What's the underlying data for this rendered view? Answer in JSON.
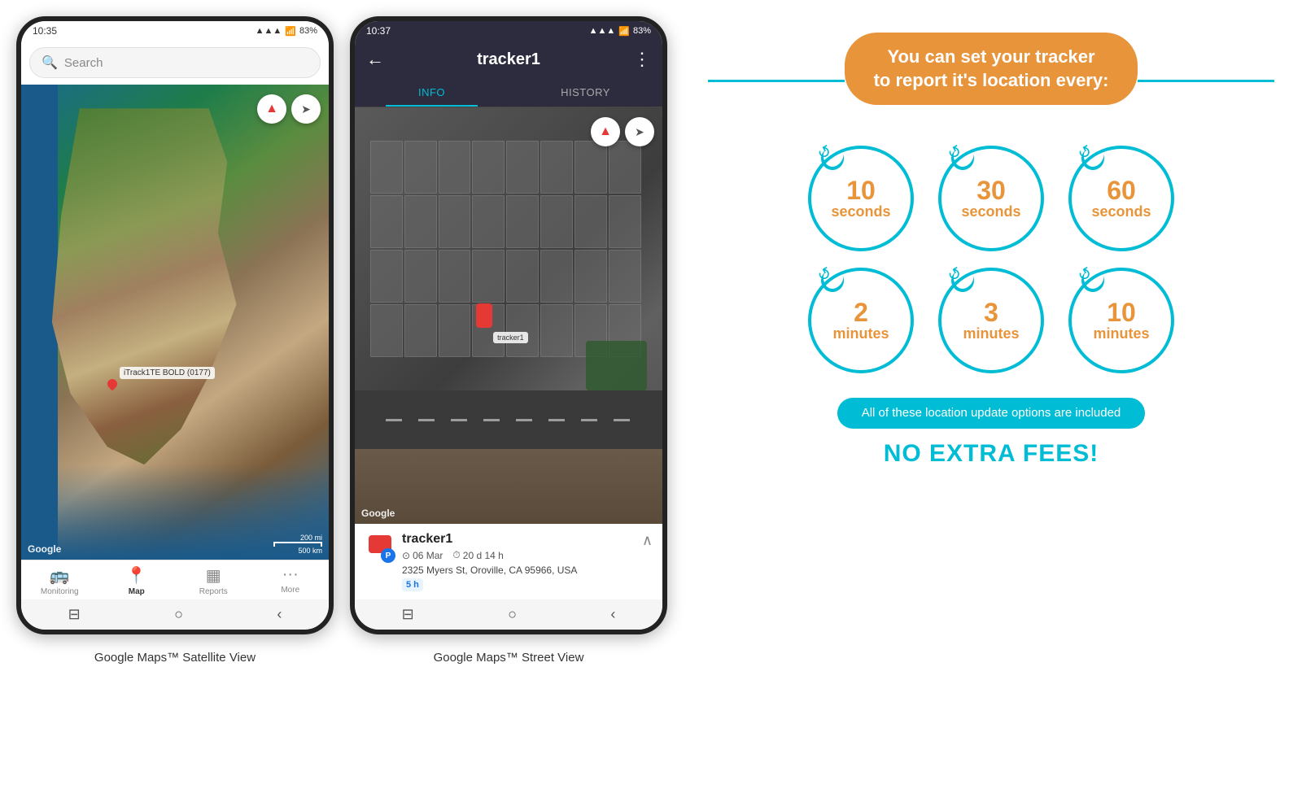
{
  "phone1": {
    "status_time": "10:35",
    "status_signal": "▲▲▲",
    "status_battery": "83%",
    "search_placeholder": "Search",
    "compass_icon": "⬆",
    "share_icon": "➤",
    "tracker_label": "iTrack1TE BOLD (0177)",
    "google_text": "Google",
    "scale_200mi": "200 mi",
    "scale_500km": "500 km",
    "nav": {
      "monitoring": "Monitoring",
      "map": "Map",
      "reports": "Reports",
      "more": "More"
    },
    "caption": "Google Maps™ Satellite View"
  },
  "phone2": {
    "status_time": "10:37",
    "status_battery": "83%",
    "back_icon": "←",
    "title": "tracker1",
    "more_icon": "⋮",
    "tab_info": "INFO",
    "tab_history": "HISTORY",
    "compass_icon": "⬆",
    "share_icon": "➤",
    "google_text": "Google",
    "tracker_map_label": "tracker1",
    "info_panel": {
      "tracker_name": "tracker1",
      "p_badge": "P",
      "date": "06 Mar",
      "duration": "20 d 14 h",
      "address": "2325 Myers St, Oroville, CA 95966, USA",
      "badge_5h": "5 h",
      "chevron": "∧"
    },
    "caption": "Google Maps™ Street View"
  },
  "infographic": {
    "title_line1": "You can set your tracker",
    "title_line2": "to report it's location every:",
    "circles": [
      {
        "number": "10",
        "unit": "seconds"
      },
      {
        "number": "30",
        "unit": "seconds"
      },
      {
        "number": "60",
        "unit": "seconds"
      },
      {
        "number": "2",
        "unit": "minutes"
      },
      {
        "number": "3",
        "unit": "minutes"
      },
      {
        "number": "10",
        "unit": "minutes"
      }
    ],
    "included_text": "All of these location update options are included",
    "no_fees": "NO EXTRA FEES!",
    "arrow": "↺"
  }
}
